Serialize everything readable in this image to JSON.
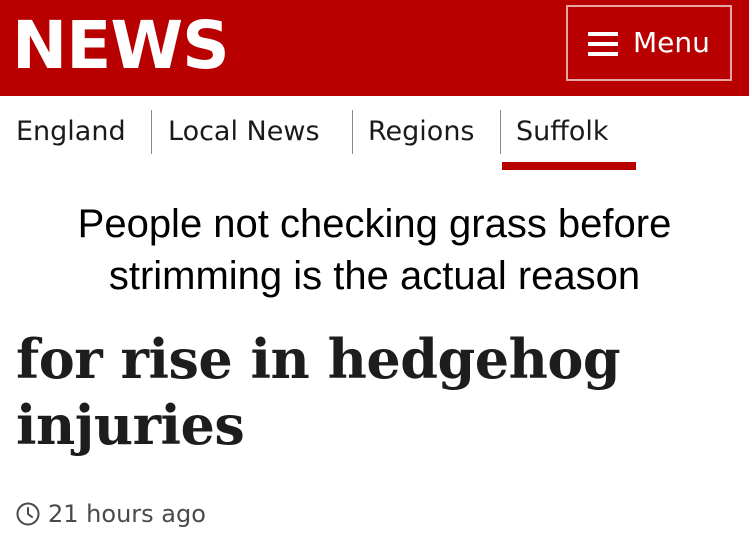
{
  "header": {
    "logo_text": "NEWS",
    "menu_label": "Menu",
    "menu_icon": "hamburger-icon",
    "background_color": "#b80000"
  },
  "nav": {
    "items": [
      {
        "label": "England"
      },
      {
        "label": "Local News"
      },
      {
        "label": "Regions"
      },
      {
        "label": "Suffolk"
      }
    ],
    "active_item": "Suffolk",
    "active_color": "#b80000"
  },
  "caption": {
    "line1": "People not checking grass before",
    "line2": "strimming is the actual reason"
  },
  "article": {
    "headline_line1": "for rise in hedgehog",
    "headline_line2": "injuries",
    "timestamp": "21 hours ago",
    "timestamp_icon": "clock-icon"
  }
}
